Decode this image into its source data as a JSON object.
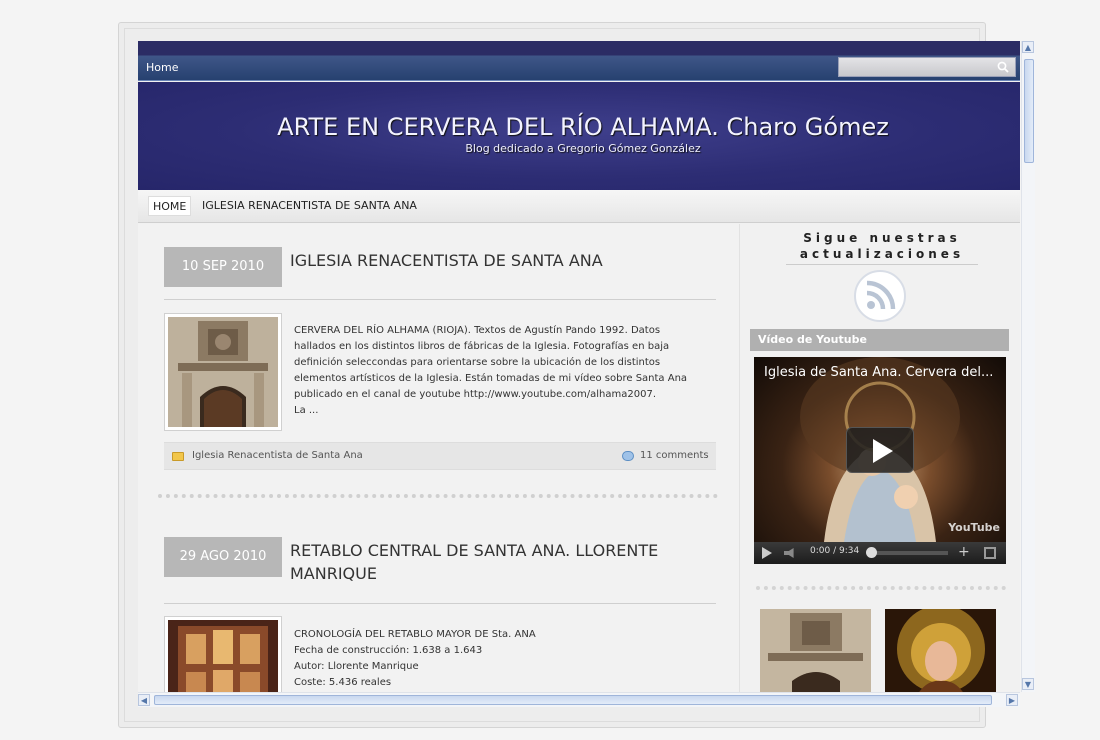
{
  "topbar": {
    "home_label": "Home",
    "search_placeholder": ""
  },
  "header": {
    "title": "ARTE EN CERVERA DEL RÍO ALHAMA. Charo Gómez",
    "description": "Blog dedicado a Gregorio Gómez González"
  },
  "nav": {
    "items": [
      {
        "label": "HOME"
      },
      {
        "label": "IGLESIA RENACENTISTA DE SANTA ANA"
      }
    ]
  },
  "posts": [
    {
      "date": "10 SEP 2010",
      "title": "IGLESIA RENACENTISTA DE SANTA ANA",
      "excerpt_lines": [
        "CERVERA DEL RÍO ALHAMA (RIOJA). Textos de Agustín Pando 1992. Datos",
        "hallados en los distintos libros de fábricas de la Iglesia. Fotografías en baja",
        "definición seleccondas para orientarse sobre la ubicación de los distintos",
        "elementos artísticos de la Iglesia. Están tomadas de mi vídeo sobre Santa Ana",
        "publicado en el canal de youtube http://www.youtube.com/alhama2007.",
        "La ..."
      ],
      "category": "Iglesia Renacentista de Santa Ana",
      "comments": "11 comments"
    },
    {
      "date": "29 AGO 2010",
      "title_lines": [
        "RETABLO CENTRAL DE SANTA ANA. LLORENTE",
        "MANRIQUE"
      ],
      "excerpt_lines": [
        "CRONOLOGÍA DEL RETABLO MAYOR DE Sta. ANA",
        "Fecha de construcción: 1.638 a 1.643",
        "Autor: Llorente Manrique",
        "Coste: 5.436 reales"
      ]
    }
  ],
  "sidebar": {
    "follow_title_lines": [
      "Sigue nuestras",
      "actualizaciones"
    ],
    "video_widget_title": "Vídeo de Youtube",
    "video": {
      "title": "Iglesia de Santa Ana. Cervera del...",
      "time": "0:00 / 9:34",
      "logo": "YouTube"
    }
  },
  "colors": {
    "header_bg": "#2d2d74",
    "date_box": "#b7b7b7",
    "widget_title_bg": "#b0b0b0"
  }
}
